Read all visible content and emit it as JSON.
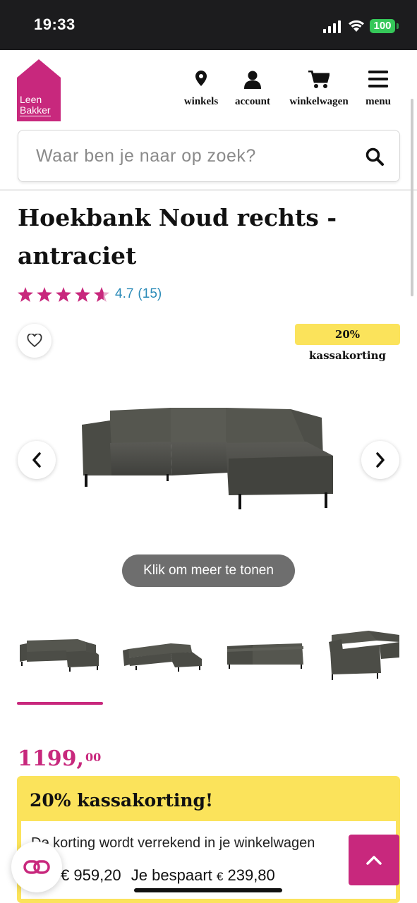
{
  "status_bar": {
    "time": "19:33",
    "battery": "100"
  },
  "brand": {
    "logo_line1": "Leen",
    "logo_line2": "Bakker",
    "accent": "#c8287d",
    "yellow": "#fbe35b"
  },
  "nav": {
    "items": [
      {
        "label": "winkels",
        "icon": "location-pin-icon"
      },
      {
        "label": "account",
        "icon": "user-icon"
      },
      {
        "label": "winkelwagen",
        "icon": "cart-icon"
      },
      {
        "label": "menu",
        "icon": "hamburger-icon"
      }
    ]
  },
  "search": {
    "placeholder": "Waar ben je naar op zoek?"
  },
  "product": {
    "title": "Hoekbank Noud rechts - antraciet",
    "rating_value": "4.7",
    "rating_count": "(15)",
    "stars": 4.7,
    "badge": "20% kassakorting",
    "show_more": "Klik om meer te tonen",
    "thumbnails": 4,
    "price_whole": "1199,",
    "price_cents": "00"
  },
  "promo": {
    "title": "20% kassakorting!",
    "desc": "De korting wordt verrekend in je winkelwagen",
    "new_price_currency": "€",
    "new_price": "959,20",
    "saving_label": "Je bespaart",
    "saving_currency": "€",
    "saving_amount": "239,80"
  }
}
